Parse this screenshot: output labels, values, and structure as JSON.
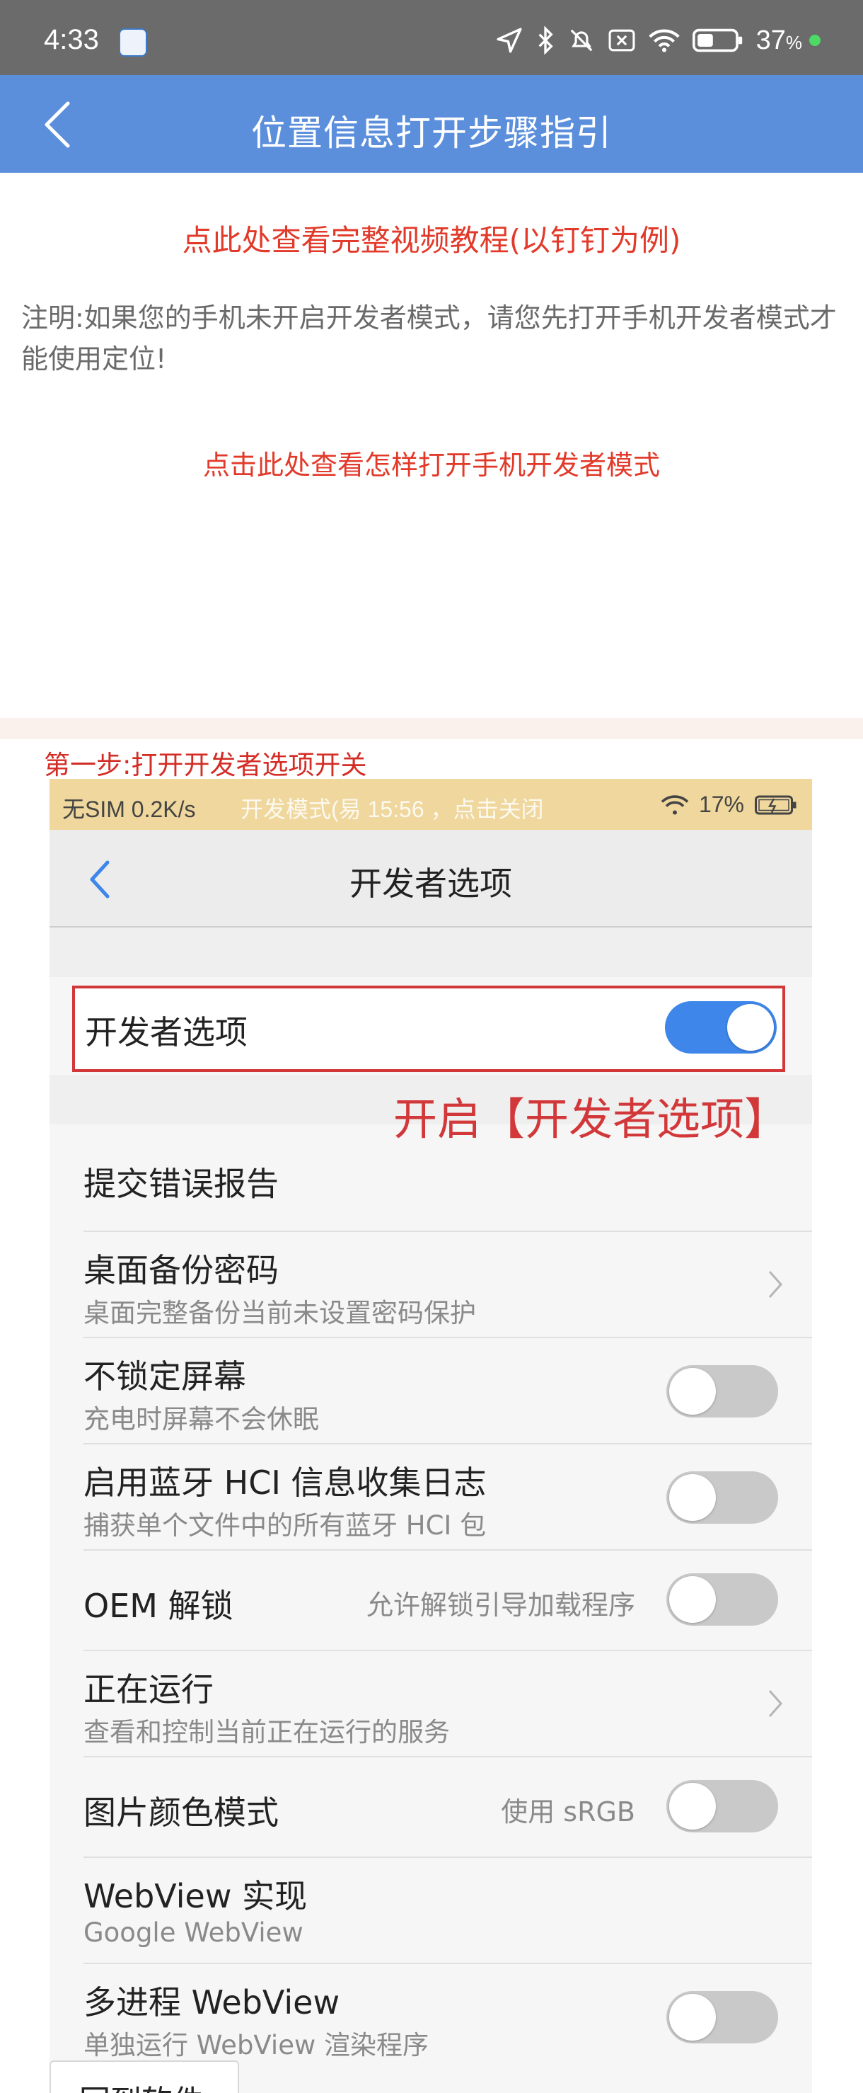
{
  "status_bar": {
    "time": "4:33",
    "battery": "37",
    "battery_unit": "%"
  },
  "header": {
    "title": "位置信息打开步骤指引"
  },
  "links": {
    "video_tutorial": "点此处查看完整视频教程(以钉钉为例)",
    "note": "注明:如果您的手机未开启开发者模式，请您先打开手机开发者模式才能使用定位!",
    "how_to_enable": "点击此处查看怎样打开手机开发者模式"
  },
  "step1": {
    "title": "第一步:打开开发者选项开关"
  },
  "inner_status": {
    "left": "无SIM 0.2K/s",
    "mid": "开发模式(易 15:56 ，点击关闭",
    "battery": "17%"
  },
  "inner_header": {
    "title": "开发者选项"
  },
  "dev_toggle": {
    "label": "开发者选项",
    "on": true
  },
  "annotation": "开启【开发者选项】",
  "settings": [
    {
      "main": "提交错误报告",
      "sub": "",
      "hint": "",
      "control": "none"
    },
    {
      "main": "桌面备份密码",
      "sub": "桌面完整备份当前未设置密码保护",
      "hint": "",
      "control": "chevron"
    },
    {
      "main": "不锁定屏幕",
      "sub": "充电时屏幕不会休眠",
      "hint": "",
      "control": "switch"
    },
    {
      "main": "启用蓝牙 HCI 信息收集日志",
      "sub": "捕获单个文件中的所有蓝牙 HCI 包",
      "hint": "",
      "control": "switch"
    },
    {
      "main": "OEM 解锁",
      "sub": "",
      "hint": "允许解锁引导加载程序",
      "control": "switch"
    },
    {
      "main": "正在运行",
      "sub": "查看和控制当前正在运行的服务",
      "hint": "",
      "control": "chevron"
    },
    {
      "main": "图片颜色模式",
      "sub": "",
      "hint": "使用 sRGB",
      "control": "switch"
    },
    {
      "main": "WebView 实现",
      "sub": "Google WebView",
      "hint": "",
      "control": "none"
    },
    {
      "main": "多进程 WebView",
      "sub": "单独运行 WebView 渲染程序",
      "hint": "",
      "control": "switch"
    }
  ],
  "bottom_tab": "回到软件"
}
